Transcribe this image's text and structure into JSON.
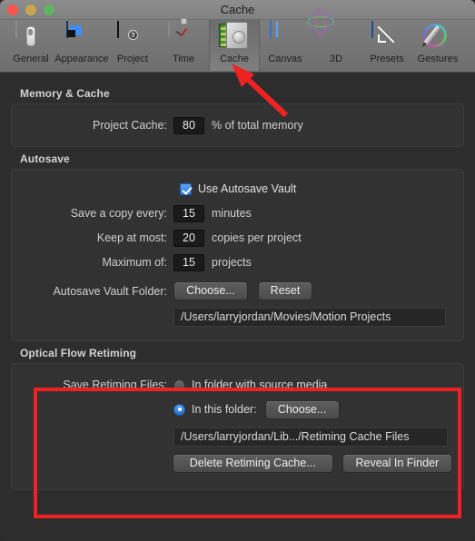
{
  "window": {
    "title": "Cache",
    "controls": [
      {
        "name": "close",
        "color": "#f8564a"
      },
      {
        "name": "minimize",
        "color": "#c9a54f"
      },
      {
        "name": "zoom",
        "color": "#5fb45f"
      }
    ]
  },
  "toolbar": {
    "items": [
      {
        "label": "General",
        "icon": "general-icon",
        "selected": false
      },
      {
        "label": "Appearance",
        "icon": "appearance-icon",
        "selected": false
      },
      {
        "label": "Project",
        "icon": "project-icon",
        "selected": false
      },
      {
        "label": "Time",
        "icon": "time-icon",
        "selected": false
      },
      {
        "label": "Cache",
        "icon": "cache-icon",
        "selected": true
      },
      {
        "label": "Canvas",
        "icon": "canvas-icon",
        "selected": false
      },
      {
        "label": "3D",
        "icon": "3d-icon",
        "selected": false
      },
      {
        "label": "Presets",
        "icon": "presets-icon",
        "selected": false
      },
      {
        "label": "Gestures",
        "icon": "gestures-icon",
        "selected": false
      }
    ]
  },
  "sections": {
    "memory_cache": {
      "title": "Memory & Cache",
      "project_cache_label": "Project Cache:",
      "project_cache_value": "80",
      "project_cache_unit": "% of total memory"
    },
    "autosave": {
      "title": "Autosave",
      "use_vault_label": "Use Autosave Vault",
      "use_vault_checked": true,
      "save_copy_label": "Save a copy every:",
      "save_copy_value": "15",
      "save_copy_unit": "minutes",
      "keep_at_most_label": "Keep at most:",
      "keep_at_most_value": "20",
      "keep_at_most_unit": "copies per project",
      "maximum_of_label": "Maximum of:",
      "maximum_of_value": "15",
      "maximum_of_unit": "projects",
      "vault_folder_label": "Autosave Vault Folder:",
      "choose_button": "Choose...",
      "reset_button": "Reset",
      "vault_path": "/Users/larryjordan/Movies/Motion Projects"
    },
    "optical_flow": {
      "title": "Optical Flow Retiming",
      "save_retiming_label": "Save Retiming Files:",
      "option_source_media": "In folder with source media",
      "option_source_media_selected": false,
      "option_this_folder": "In this folder:",
      "option_this_folder_selected": true,
      "choose_button": "Choose...",
      "retiming_path": "/Users/larryjordan/Lib.../Retiming Cache Files",
      "delete_cache_button": "Delete Retiming Cache...",
      "reveal_finder_button": "Reveal In Finder"
    }
  },
  "annotations": {
    "highlight_color": "#ee2222",
    "arrow": {
      "name": "red-arrow-pointing-to-cache-tab"
    },
    "rectangle": {
      "name": "red-highlight-optical-flow-retiming"
    }
  }
}
